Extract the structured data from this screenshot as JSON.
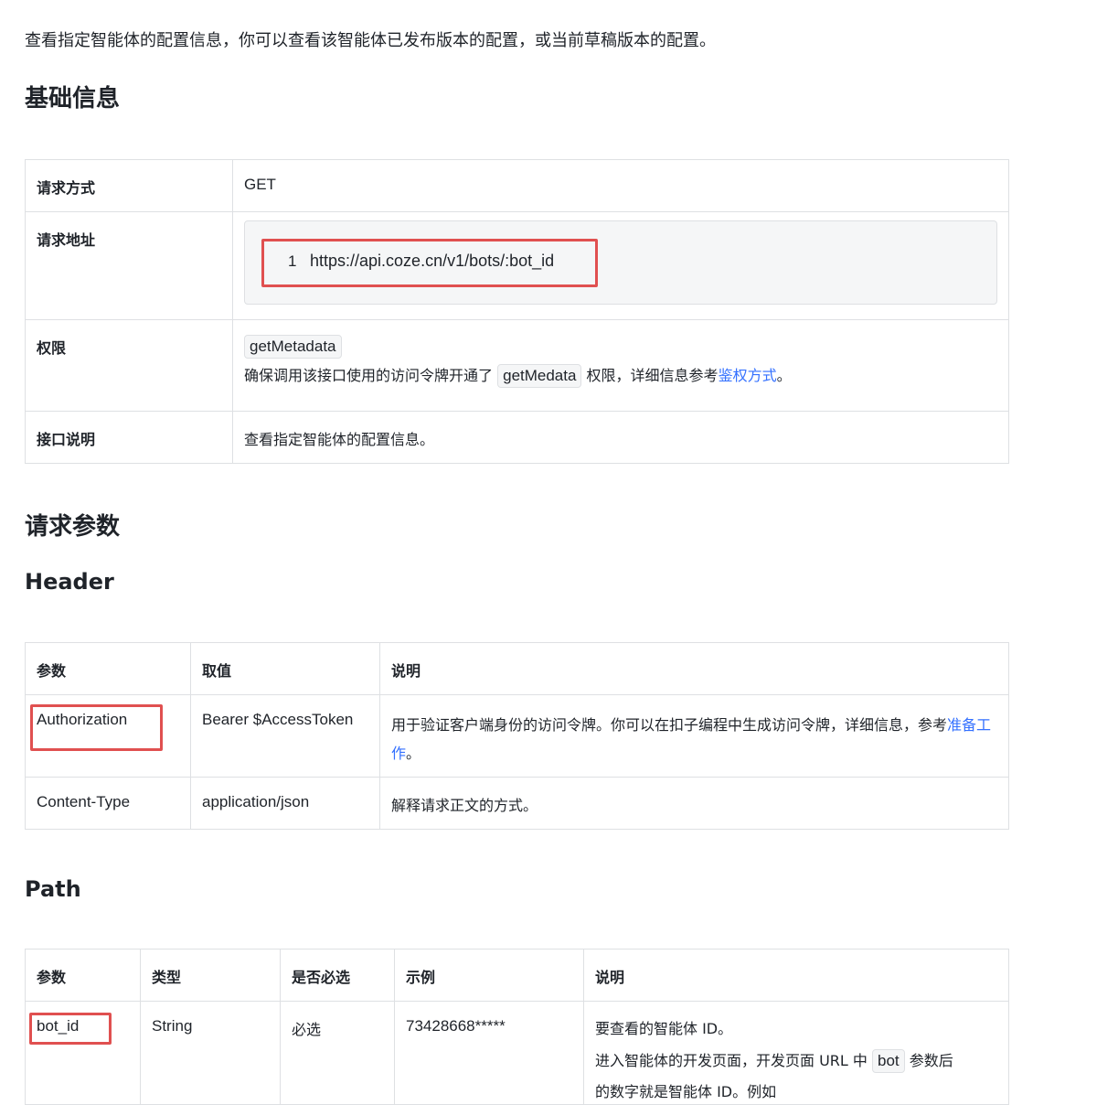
{
  "intro": "查看指定智能体的配置信息，你可以查看该智能体已发布版本的配置，或当前草稿版本的配置。",
  "sections": {
    "basic": "基础信息",
    "request_params": "请求参数",
    "header": "Header",
    "path": "Path"
  },
  "basic": {
    "method_key": "请求方式",
    "method_value": "GET",
    "url_key": "请求地址",
    "url_line": "1",
    "url_value": "https://api.coze.cn/v1/bots/:bot_id",
    "perm_key": "权限",
    "perm_code": "getMetadata",
    "perm_text_1": "确保调用该接口使用的访问令牌开通了",
    "perm_code_2": "getMedata",
    "perm_text_2": "权限，详细信息参考",
    "perm_link": "鉴权方式",
    "perm_text_3": "。",
    "desc_key": "接口说明",
    "desc_value": "查看指定智能体的配置信息。"
  },
  "header_table": {
    "columns": [
      "参数",
      "取值",
      "说明"
    ],
    "rows": [
      {
        "param": "Authorization",
        "value": "Bearer $AccessToken",
        "desc": "用于验证客户端身份的访问令牌。你可以在扣子编程中生成访问令牌，详细信息，参考",
        "desc_link": "准备工作",
        "desc_tail": "。"
      },
      {
        "param": "Content-Type",
        "value": "application/json",
        "desc": "解释请求正文的方式。"
      }
    ]
  },
  "path_table": {
    "columns": [
      "参数",
      "类型",
      "是否必选",
      "示例",
      "说明"
    ],
    "rows": [
      {
        "param": "bot_id",
        "type": "String",
        "required": "必选",
        "example": "73428668*****",
        "desc_1": "要查看的智能体 ID。",
        "desc_2_pre": "进入智能体的开发页面，开发页面 URL 中",
        "desc_2_code": "bot",
        "desc_2_post": "参数后",
        "desc_3": "的数字就是智能体 ID。例如"
      }
    ]
  },
  "colors": {
    "highlight": "#e05050",
    "link": "#3370ff",
    "border": "#dee0e3"
  }
}
